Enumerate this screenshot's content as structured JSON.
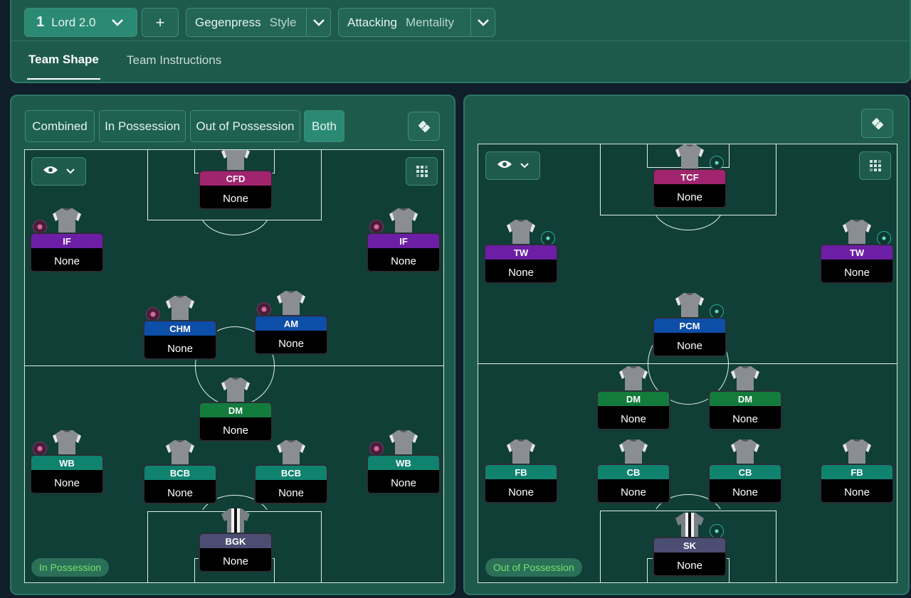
{
  "header": {
    "tactic_number": "1",
    "tactic_name": "Lord 2.0",
    "add_label": "+",
    "style_value": "Gegenpress",
    "style_label": "Style",
    "mentality_value": "Attacking",
    "mentality_label": "Mentality"
  },
  "tabs": {
    "team_shape": "Team Shape",
    "team_instructions": "Team Instructions"
  },
  "filters": {
    "combined": "Combined",
    "in_possession": "In Possession",
    "out_of_possession": "Out of Possession",
    "both": "Both",
    "active": "Both"
  },
  "left_pitch": {
    "phase_label": "In Possession",
    "players": [
      {
        "role": "CFD",
        "duty": "None",
        "color": "#a0246e",
        "dot": "none"
      },
      {
        "role": "IF",
        "duty": "None",
        "color": "#6c1fa5",
        "dot": "pink"
      },
      {
        "role": "IF",
        "duty": "None",
        "color": "#6c1fa5",
        "dot": "pink"
      },
      {
        "role": "CHM",
        "duty": "None",
        "color": "#0d4ea8",
        "dot": "pink"
      },
      {
        "role": "AM",
        "duty": "None",
        "color": "#0d4ea8",
        "dot": "pink"
      },
      {
        "role": "DM",
        "duty": "None",
        "color": "#137c3d",
        "dot": "none"
      },
      {
        "role": "WB",
        "duty": "None",
        "color": "#10836f",
        "dot": "pink"
      },
      {
        "role": "BCB",
        "duty": "None",
        "color": "#10836f",
        "dot": "none"
      },
      {
        "role": "BCB",
        "duty": "None",
        "color": "#10836f",
        "dot": "none"
      },
      {
        "role": "WB",
        "duty": "None",
        "color": "#10836f",
        "dot": "pink"
      },
      {
        "role": "BGK",
        "duty": "None",
        "color": "#4b4d73",
        "dot": "none"
      }
    ]
  },
  "right_pitch": {
    "phase_label": "Out of Possession",
    "players": [
      {
        "role": "TCF",
        "duty": "None",
        "color": "#a0246e",
        "dot": "teal"
      },
      {
        "role": "TW",
        "duty": "None",
        "color": "#6c1fa5",
        "dot": "teal"
      },
      {
        "role": "TW",
        "duty": "None",
        "color": "#6c1fa5",
        "dot": "teal"
      },
      {
        "role": "PCM",
        "duty": "None",
        "color": "#0d4ea8",
        "dot": "teal"
      },
      {
        "role": "DM",
        "duty": "None",
        "color": "#137c3d",
        "dot": "none"
      },
      {
        "role": "DM",
        "duty": "None",
        "color": "#137c3d",
        "dot": "none"
      },
      {
        "role": "FB",
        "duty": "None",
        "color": "#10836f",
        "dot": "none"
      },
      {
        "role": "CB",
        "duty": "None",
        "color": "#10836f",
        "dot": "none"
      },
      {
        "role": "CB",
        "duty": "None",
        "color": "#10836f",
        "dot": "none"
      },
      {
        "role": "FB",
        "duty": "None",
        "color": "#10836f",
        "dot": "none"
      },
      {
        "role": "SK",
        "duty": "None",
        "color": "#4b4d73",
        "dot": "teal"
      }
    ]
  },
  "icons": {
    "chevron": "chevron-down-icon",
    "eye": "eye-icon",
    "grid": "grid-icon",
    "ticket": "ticket-icon",
    "shirt": "shirt-icon"
  }
}
